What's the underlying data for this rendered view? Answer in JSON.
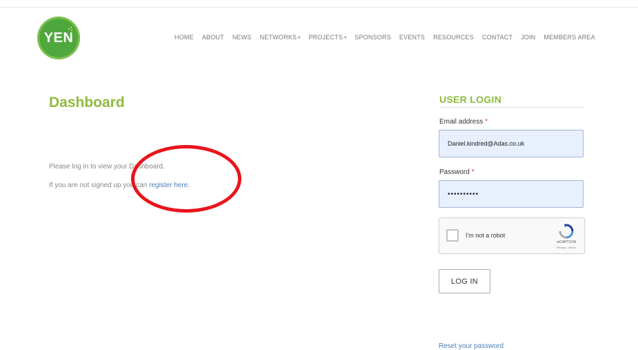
{
  "header": {
    "logo_text": "YEN",
    "nav": [
      {
        "label": "HOME",
        "dropdown": false
      },
      {
        "label": "ABOUT",
        "dropdown": false
      },
      {
        "label": "NEWS",
        "dropdown": false
      },
      {
        "label": "NETWORKS",
        "dropdown": true
      },
      {
        "label": "PROJECTS",
        "dropdown": true
      },
      {
        "label": "SPONSORS",
        "dropdown": false
      },
      {
        "label": "EVENTS",
        "dropdown": false
      },
      {
        "label": "RESOURCES",
        "dropdown": false
      },
      {
        "label": "CONTACT",
        "dropdown": false
      },
      {
        "label": "JOIN",
        "dropdown": false
      },
      {
        "label": "MEMBERS AREA",
        "dropdown": false
      }
    ]
  },
  "main": {
    "title": "Dashboard",
    "line1": "Please log in to view your Dashboard.",
    "line2_prefix": "If you are not signed up you can ",
    "register_link": "register here."
  },
  "login": {
    "heading": "USER LOGIN",
    "email_label": "Email address",
    "email_value": "Daniel.kindred@Adas.co.uk",
    "password_label": "Password",
    "password_value": "••••••••••",
    "required_marker": "*",
    "recaptcha_label": "I'm not a robot",
    "recaptcha_brand": "reCAPTCHA",
    "recaptcha_terms": "Privacy - Terms",
    "button_label": "LOG IN",
    "reset_link": "Reset your password"
  },
  "colors": {
    "brand_green": "#8dbb3e",
    "logo_green": "#4fa83d",
    "link_blue": "#4a7fb0",
    "annotation_red": "#e8141c",
    "input_bg": "#e8f0fe"
  },
  "icons": {
    "recaptcha": "recaptcha-logo-icon",
    "dropdown": "chevron-down-icon"
  }
}
